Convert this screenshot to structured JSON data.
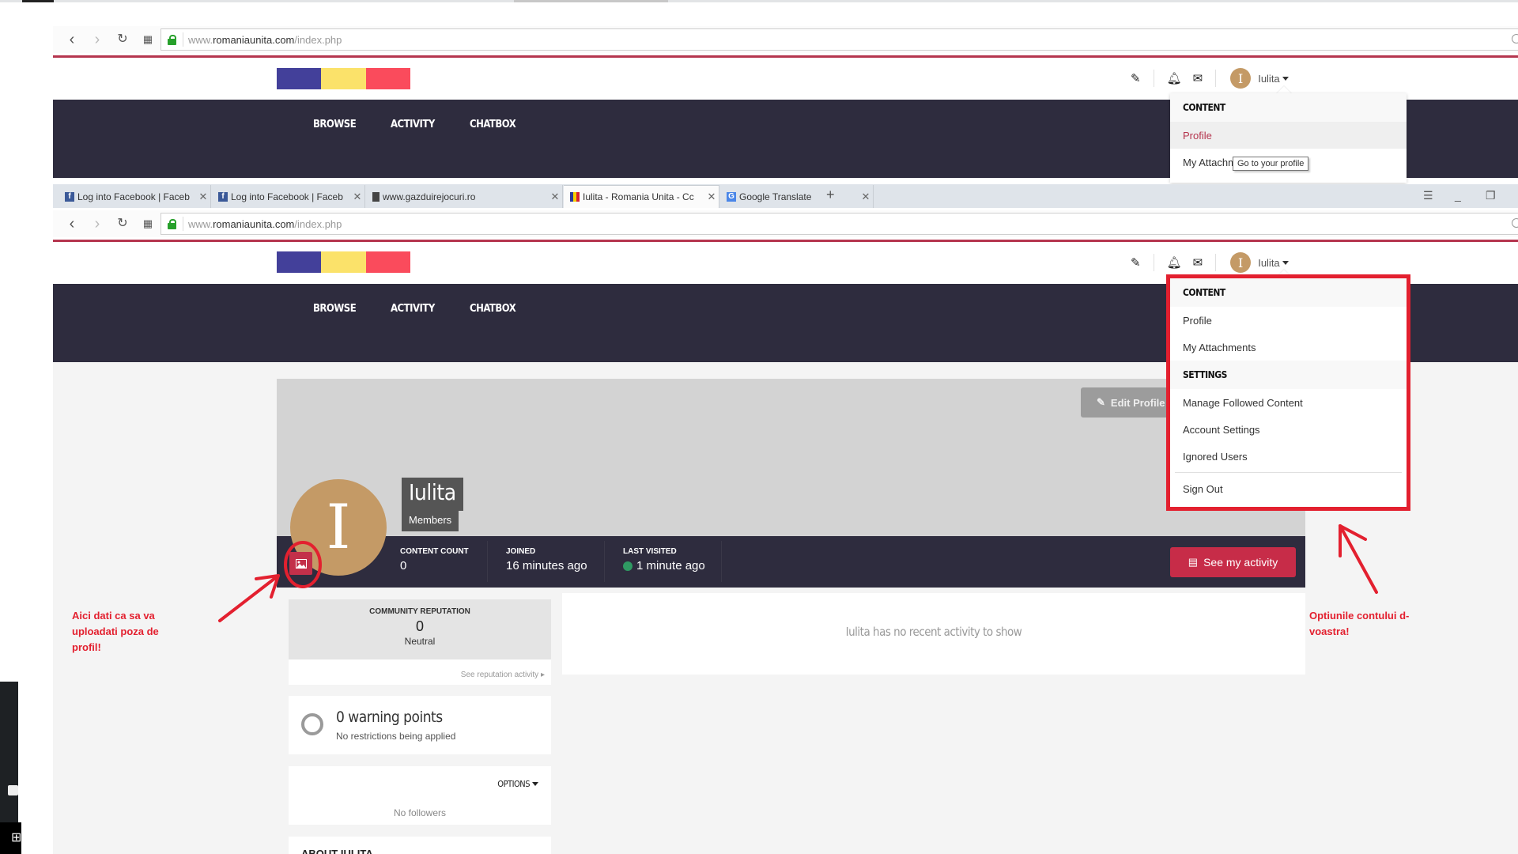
{
  "browser": {
    "url_prefix": "www.",
    "url_domain": "romaniaunita.com",
    "url_path": "/index.php",
    "tabs": [
      {
        "label": "Log into Facebook | Faceb",
        "icon": "facebook-icon",
        "active": false
      },
      {
        "label": "Log into Facebook | Faceb",
        "icon": "facebook-icon",
        "active": false
      },
      {
        "label": "www.gazduirejocuri.ro",
        "icon": "page-icon",
        "active": false
      },
      {
        "label": "Iulita - Romania Unita - Cc",
        "icon": "romania-flag-icon",
        "active": true
      },
      {
        "label": "Google Translate",
        "icon": "google-translate-icon",
        "active": false
      }
    ],
    "new_tab": "+",
    "close_glyph": "✕"
  },
  "site": {
    "flag_colors": [
      "#43409a",
      "#fbe26a",
      "#fa4b5c"
    ],
    "accent": "#b5354e",
    "nav_bg": "#2e2c3e",
    "nav": [
      "BROWSE",
      "ACTIVITY",
      "CHATBOX"
    ],
    "user": {
      "initial": "I",
      "name": "Iulita"
    }
  },
  "dropdown_first": {
    "section": "CONTENT",
    "items": [
      "Profile",
      "My Attachments"
    ],
    "tooltip": "Go to your profile"
  },
  "dropdown": {
    "sections": [
      {
        "title": "CONTENT",
        "items": [
          "Profile",
          "My Attachments"
        ]
      },
      {
        "title": "SETTINGS",
        "items": [
          "Manage Followed Content",
          "Account Settings",
          "Ignored Users"
        ]
      }
    ],
    "sign_out": "Sign Out"
  },
  "profile": {
    "initial": "I",
    "name": "Iulita",
    "group": "Members",
    "edit_profile": "Edit Profile",
    "stats": [
      {
        "label": "CONTENT COUNT",
        "value": "0"
      },
      {
        "label": "JOINED",
        "value": "16 minutes ago"
      },
      {
        "label": "LAST VISITED",
        "value": "1 minute ago",
        "online": true
      }
    ],
    "see_activity": "See my activity",
    "reputation": {
      "title": "COMMUNITY REPUTATION",
      "value": "0",
      "label": "Neutral",
      "link": "See reputation activity"
    },
    "warnings": {
      "title": "0 warning points",
      "sub": "No restrictions being applied"
    },
    "followers": {
      "options": "OPTIONS",
      "empty": "No followers"
    },
    "about_title": "ABOUT IULITA",
    "no_activity": "Iulita has no recent activity to show"
  },
  "annotations": {
    "left": "Aici dati ca sa va uploadati poza de profil!",
    "right": "Optiunile contului d-voastra!",
    "color": "#e3202f"
  }
}
